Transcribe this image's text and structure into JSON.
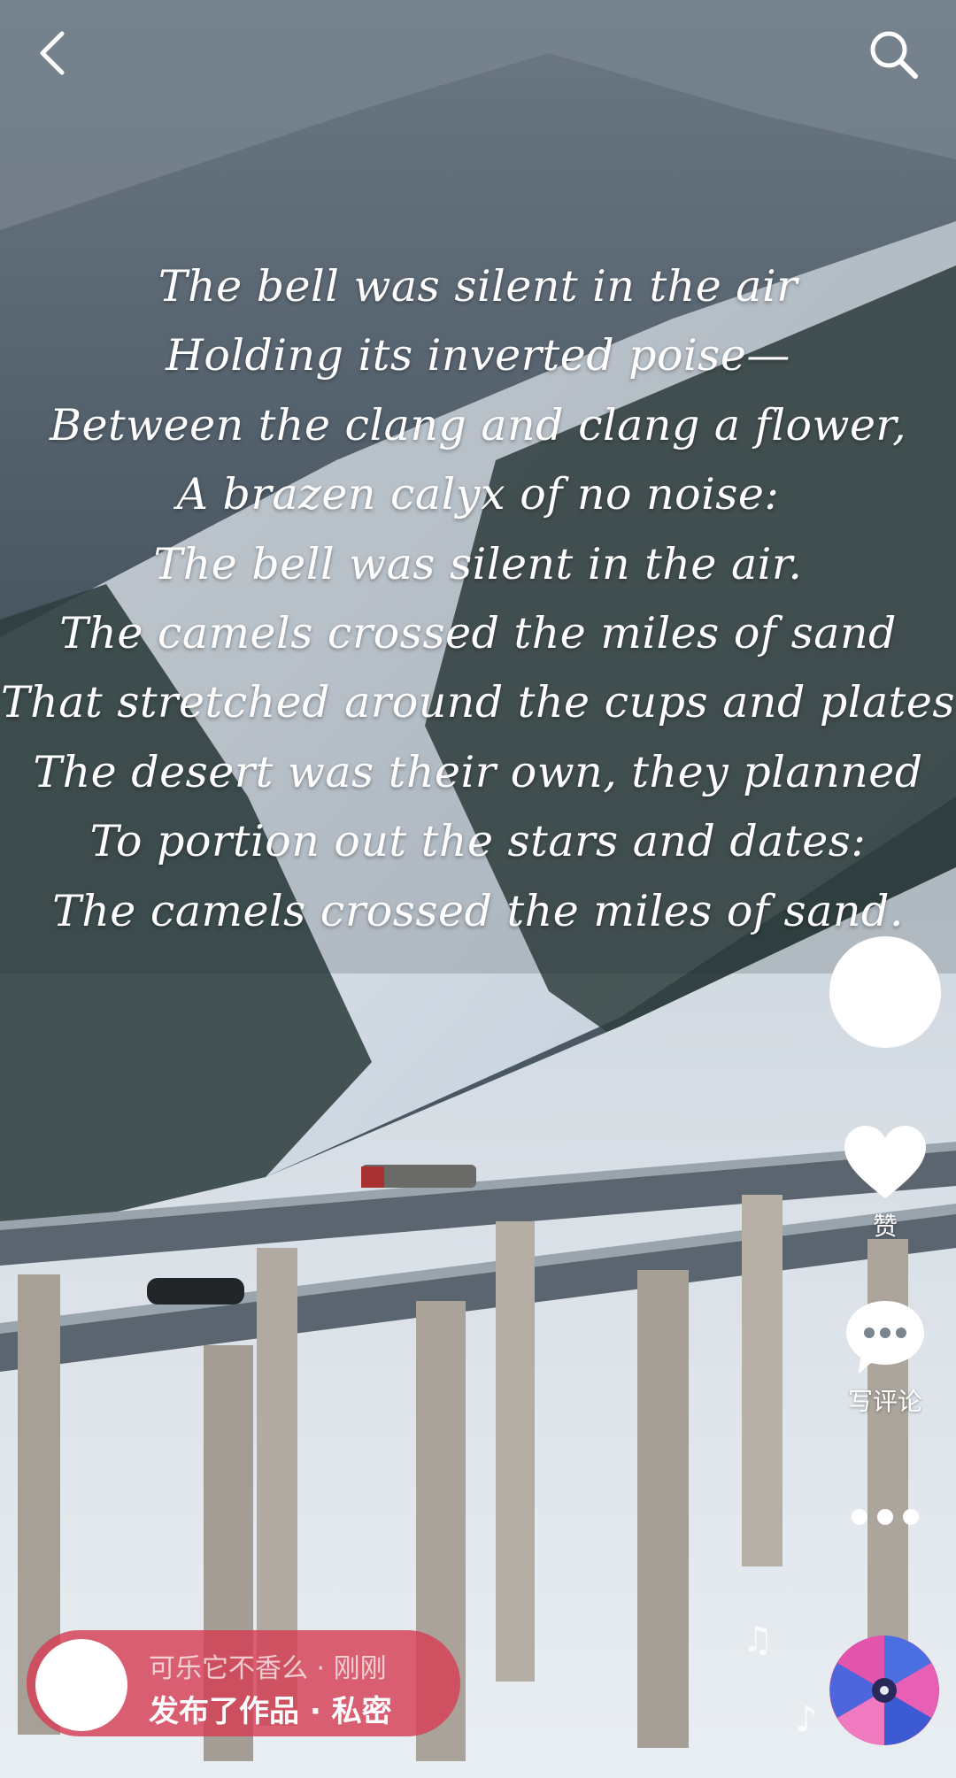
{
  "poem": {
    "lines": [
      "The bell was silent in the air",
      "Holding its inverted poise—",
      "Between the clang and clang a flower,",
      "A brazen calyx of no noise:",
      "The bell was silent in the air.",
      "The camels crossed the miles of sand",
      "That stretched around the cups and plates",
      "The desert was their own, they planned",
      "To portion out the stars and dates:",
      "The camels crossed the miles of sand."
    ]
  },
  "side_actions": {
    "like_label": "赞",
    "comment_label": "写评论"
  },
  "notice": {
    "line1": "可乐它不香么 · 刚刚",
    "line2": "发布了作品 · 私密"
  },
  "icons": {
    "back": "chevron-left-icon",
    "search": "search-icon",
    "like": "heart-icon",
    "comment": "speech-bubble-icon",
    "more": "more-icon",
    "music": "music-note-icon"
  }
}
